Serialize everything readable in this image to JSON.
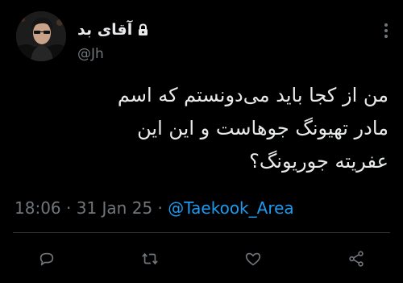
{
  "author": {
    "display_name": "آقای بد",
    "handle": "@Jh",
    "protected_icon": "lock-icon",
    "avatar_icon": "avatar-photo"
  },
  "tweet": {
    "text": "من از کجا باید می‌دونستم که اسم\nمادر تهیونگ جوهاست و این این\nعفریته جوریونگ؟",
    "time": "18:06",
    "separator": " · ",
    "date": "31 Jan 25",
    "source": "@Taekook_Area"
  },
  "actions": [
    {
      "name": "reply",
      "icon": "reply-icon"
    },
    {
      "name": "retweet",
      "icon": "retweet-icon"
    },
    {
      "name": "like",
      "icon": "heart-icon"
    },
    {
      "name": "share",
      "icon": "share-icon"
    }
  ],
  "colors": {
    "background": "#000000",
    "text": "#e7e9ea",
    "muted": "#71767b",
    "link": "#1d9bf0",
    "divider": "#2f3336"
  }
}
